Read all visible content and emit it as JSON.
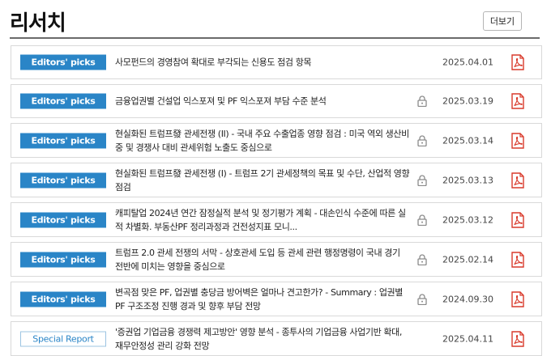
{
  "header": {
    "title": "리서치",
    "more_label": "더보기"
  },
  "rows": [
    {
      "badge": "Editors' picks",
      "badge_type": "editors",
      "title": "사모펀드의 경영참여 확대로 부각되는 신용도 점검 항목",
      "locked": false,
      "date": "2025.04.01"
    },
    {
      "badge": "Editors' picks",
      "badge_type": "editors",
      "title": "금융업권별 건설업 익스포져 및 PF 익스포져 부담 수준 분석",
      "locked": true,
      "date": "2025.03.19"
    },
    {
      "badge": "Editors' picks",
      "badge_type": "editors",
      "title": "현실화된 트럼프發 관세전쟁 (II) - 국내 주요 수출업종 영향 점검 : 미국 역외 생산비중 및 경쟁사 대비 관세위험 노출도 중심으로",
      "locked": true,
      "date": "2025.03.14"
    },
    {
      "badge": "Editors' picks",
      "badge_type": "editors",
      "title": "현실화된 트럼프發 관세전쟁 (I) - 트럼프 2기 관세정책의 목표 및 수단, 산업적 영향 점검",
      "locked": true,
      "date": "2025.03.13"
    },
    {
      "badge": "Editors' picks",
      "badge_type": "editors",
      "title": "캐피탈업 2024년 연간 잠정실적 분석 및 정기평가 계획 - 대손인식 수준에 따른 실적 차별화. 부동산PF 정리과정과 건전성지표 모니...",
      "locked": true,
      "date": "2025.03.12"
    },
    {
      "badge": "Editors' picks",
      "badge_type": "editors",
      "title": "트럼프 2.0 관세 전쟁의 서막 - 상호관세 도입 등 관세 관련 행정명령이 국내 경기 전반에 미치는 영향을 중심으로",
      "locked": true,
      "date": "2025.02.14"
    },
    {
      "badge": "Editors' picks",
      "badge_type": "editors",
      "title": "변곡점 맞은 PF, 업권별 충당금 방어벽은 얼마나 견고한가? - Summary : 업권별 PF 구조조정 진행 경과 및 향후 부담 전망",
      "locked": true,
      "date": "2024.09.30"
    },
    {
      "badge": "Special Report",
      "badge_type": "special",
      "title": "'증권업 기업금융 경쟁력 제고방안' 영향 분석 - 종투사의 기업금융 사업기반 확대, 재무안정성 관리 강화 전망",
      "locked": false,
      "date": "2025.04.11"
    }
  ],
  "colors": {
    "accent": "#2a85c7",
    "pdf": "#d93a2b",
    "lock": "#8a8a8a"
  },
  "icons": {
    "lock": "lock-icon",
    "pdf": "pdf-icon"
  }
}
